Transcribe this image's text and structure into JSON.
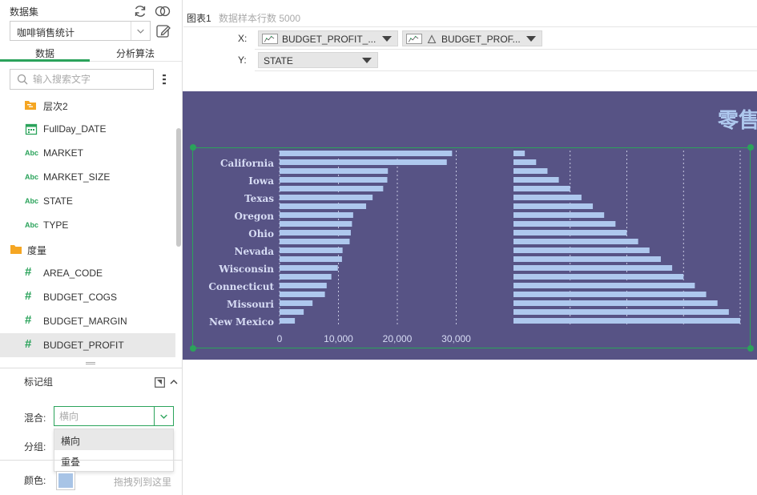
{
  "dataset": {
    "label": "数据集",
    "selected": "咖啡销售统计"
  },
  "tabs": {
    "data": "数据",
    "algorithms": "分析算法"
  },
  "search": {
    "placeholder": "输入搜索文字"
  },
  "fields": [
    {
      "type": "hierarchy",
      "icon": "hierarchy-icon",
      "label": "层次2"
    },
    {
      "type": "date",
      "icon": "calendar-icon",
      "label": "FullDay_DATE"
    },
    {
      "type": "text",
      "icon": "abc-icon",
      "label": "MARKET"
    },
    {
      "type": "text",
      "icon": "abc-icon",
      "label": "MARKET_SIZE"
    },
    {
      "type": "text",
      "icon": "abc-icon",
      "label": "STATE"
    },
    {
      "type": "text",
      "icon": "abc-icon",
      "label": "TYPE"
    },
    {
      "type": "folder",
      "icon": "folder-icon",
      "label": "度量"
    },
    {
      "type": "measure",
      "icon": "hash-icon",
      "label": "AREA_CODE"
    },
    {
      "type": "measure",
      "icon": "hash-icon",
      "label": "BUDGET_COGS"
    },
    {
      "type": "measure",
      "icon": "hash-icon",
      "label": "BUDGET_MARGIN"
    },
    {
      "type": "measure",
      "icon": "hash-icon",
      "label": "BUDGET_PROFIT",
      "selected": true
    }
  ],
  "mark_group": {
    "title": "标记组",
    "mix_label": "混合:",
    "mix_placeholder": "横向",
    "group_label": "分组:",
    "options": [
      "横向",
      "重叠"
    ],
    "color_label": "颜色:",
    "color_value": "#a8c4e6",
    "drag_hint": "拖拽列到这里"
  },
  "chart_header": {
    "tab": "图表1",
    "sample": "数据样本行数 5000"
  },
  "shelves": {
    "x_label": "X:",
    "x_pills": [
      "BUDGET_PROFIT_...",
      "BUDGET_PROF..."
    ],
    "y_label": "Y:",
    "y_pills": [
      "STATE"
    ]
  },
  "colors": {
    "accent": "#2ba35b",
    "chart_bg": "#575385",
    "bar": "#aec8ee",
    "label": "#d7dcf4"
  },
  "chart_data": {
    "type": "bar",
    "orientation": "horizontal",
    "title": "零售",
    "y_tick_labels": [
      "California",
      "Iowa",
      "Texas",
      "Oregon",
      "Ohio",
      "Nevada",
      "Wisconsin",
      "Connecticut",
      "Missouri",
      "New Mexico"
    ],
    "x_ticks_left": [
      "0",
      "10,000",
      "20,000",
      "30,000"
    ],
    "series": [
      {
        "values": [
          29300,
          28400,
          18400,
          18300,
          17600,
          15800,
          14700,
          12500,
          12300,
          12100,
          11900,
          10700,
          10600,
          9900,
          8800,
          8000,
          7700,
          5600,
          4100,
          2600
        ]
      },
      {
        "values": [
          20,
          40,
          60,
          80,
          100,
          120,
          140,
          160,
          180,
          200,
          220,
          240,
          260,
          280,
          300,
          320,
          340,
          360,
          380,
          400
        ]
      }
    ],
    "xlim_left": [
      0,
      40000
    ],
    "xlim_right": [
      0,
      400
    ],
    "grid": true
  }
}
